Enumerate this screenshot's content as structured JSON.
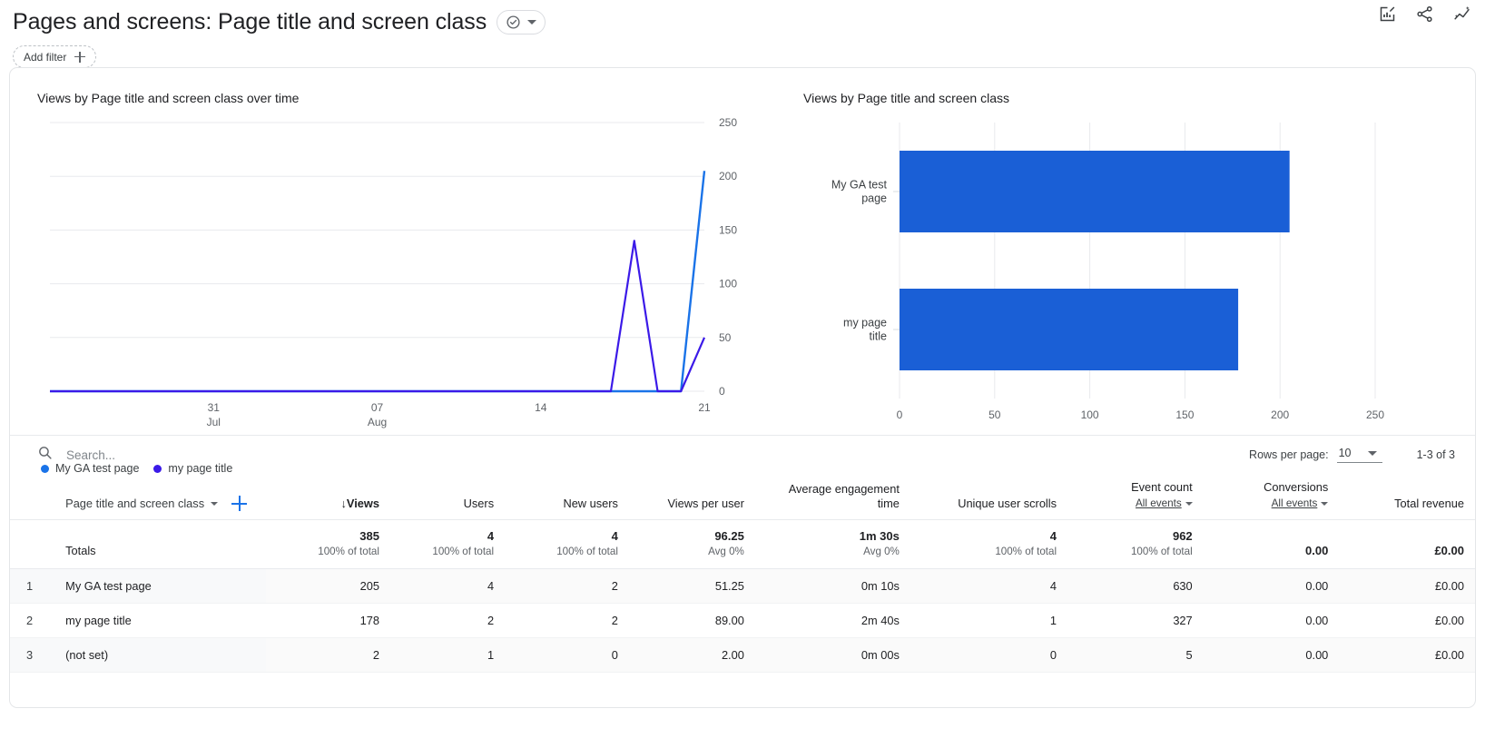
{
  "header": {
    "title": "Pages and screens: Page title and screen class",
    "title_chip_icon": "check-circle-icon",
    "add_filter_label": "Add filter",
    "icons": [
      "edit-chart-icon",
      "share-icon",
      "insights-icon"
    ]
  },
  "line_card": {
    "title": "Views by Page title and screen class"
  },
  "bar_card": {
    "title": "Views by Page title and screen class"
  },
  "legend": [
    {
      "label": "My GA test page",
      "color": "#1a73e8"
    },
    {
      "label": "my page title",
      "color": "#3b1ae8"
    }
  ],
  "toolbar": {
    "search_placeholder": "Search...",
    "search_value": "",
    "rows_per_page_label": "Rows per page:",
    "rows_per_page_value": "10",
    "range_label": "1-3 of 3"
  },
  "table": {
    "columns": [
      {
        "label": "Page title and screen class",
        "sorted": false,
        "type": "dimension"
      },
      {
        "label": "Views",
        "sorted": true,
        "sort_arrow": "↓"
      },
      {
        "label": "Users",
        "sorted": false
      },
      {
        "label": "New users",
        "sorted": false
      },
      {
        "label": "Views per user",
        "sorted": false
      },
      {
        "label": "Average engagement time",
        "sorted": false
      },
      {
        "label": "Unique user scrolls",
        "sorted": false
      },
      {
        "label": "Event count",
        "sorted": false,
        "sub": "All events"
      },
      {
        "label": "Conversions",
        "sorted": false,
        "sub": "All events"
      },
      {
        "label": "Total revenue",
        "sorted": false
      }
    ],
    "totals": {
      "label": "Totals",
      "cells": [
        {
          "main": "385",
          "sub": "100% of total"
        },
        {
          "main": "4",
          "sub": "100% of total"
        },
        {
          "main": "4",
          "sub": "100% of total"
        },
        {
          "main": "96.25",
          "sub": "Avg 0%"
        },
        {
          "main": "1m 30s",
          "sub": "Avg 0%"
        },
        {
          "main": "4",
          "sub": "100% of total"
        },
        {
          "main": "962",
          "sub": "100% of total"
        },
        {
          "main": "0.00",
          "sub": ""
        },
        {
          "main": "£0.00",
          "sub": ""
        }
      ]
    },
    "rows": [
      {
        "index": "1",
        "name": "My GA test page",
        "views": "205",
        "users": "4",
        "new_users": "2",
        "views_per_user": "51.25",
        "avg_engagement": "0m 10s",
        "unique_user_scrolls": "4",
        "event_count": "630",
        "conversions": "0.00",
        "total_revenue": "£0.00"
      },
      {
        "index": "2",
        "name": "my page title",
        "views": "178",
        "users": "2",
        "new_users": "2",
        "views_per_user": "89.00",
        "avg_engagement": "2m 40s",
        "unique_user_scrolls": "1",
        "event_count": "327",
        "conversions": "0.00",
        "total_revenue": "£0.00"
      },
      {
        "index": "3",
        "name": "(not set)",
        "views": "2",
        "users": "1",
        "new_users": "0",
        "views_per_user": "2.00",
        "avg_engagement": "0m 00s",
        "unique_user_scrolls": "0",
        "event_count": "5",
        "conversions": "0.00",
        "total_revenue": "£0.00"
      }
    ]
  },
  "chart_data": [
    {
      "type": "line",
      "title": "Views by Page title and screen class over time",
      "xlabel": "",
      "ylabel": "",
      "ylim": [
        0,
        250
      ],
      "yticks": [
        0,
        50,
        100,
        150,
        200,
        250
      ],
      "xticks": [
        {
          "pos": 7,
          "label": "31",
          "sublabel": "Jul"
        },
        {
          "pos": 14,
          "label": "07",
          "sublabel": "Aug"
        },
        {
          "pos": 21,
          "label": "14",
          "sublabel": ""
        },
        {
          "pos": 28,
          "label": "21",
          "sublabel": ""
        }
      ],
      "x": [
        0,
        1,
        2,
        3,
        4,
        5,
        6,
        7,
        8,
        9,
        10,
        11,
        12,
        13,
        14,
        15,
        16,
        17,
        18,
        19,
        20,
        21,
        22,
        23,
        24,
        25,
        26,
        27,
        28
      ],
      "grid": true,
      "legend_position": "bottom-left",
      "series": [
        {
          "name": "My GA test page",
          "color": "#1a73e8",
          "values": [
            0,
            0,
            0,
            0,
            0,
            0,
            0,
            0,
            0,
            0,
            0,
            0,
            0,
            0,
            0,
            0,
            0,
            0,
            0,
            0,
            0,
            0,
            0,
            0,
            0,
            0,
            0,
            0,
            205
          ]
        },
        {
          "name": "my page title",
          "color": "#3b1ae8",
          "values": [
            0,
            0,
            0,
            0,
            0,
            0,
            0,
            0,
            0,
            0,
            0,
            0,
            0,
            0,
            0,
            0,
            0,
            0,
            0,
            0,
            0,
            0,
            0,
            0,
            0,
            140,
            0,
            0,
            50
          ]
        }
      ]
    },
    {
      "type": "bar",
      "orientation": "horizontal",
      "title": "Views by Page title and screen class",
      "categories": [
        "My GA test page",
        "my page title"
      ],
      "values": [
        205,
        178
      ],
      "color": "#1a5fd6",
      "xlabel": "",
      "ylabel": "",
      "xlim": [
        0,
        250
      ],
      "xticks": [
        0,
        50,
        100,
        150,
        200,
        250
      ],
      "grid": true
    }
  ]
}
